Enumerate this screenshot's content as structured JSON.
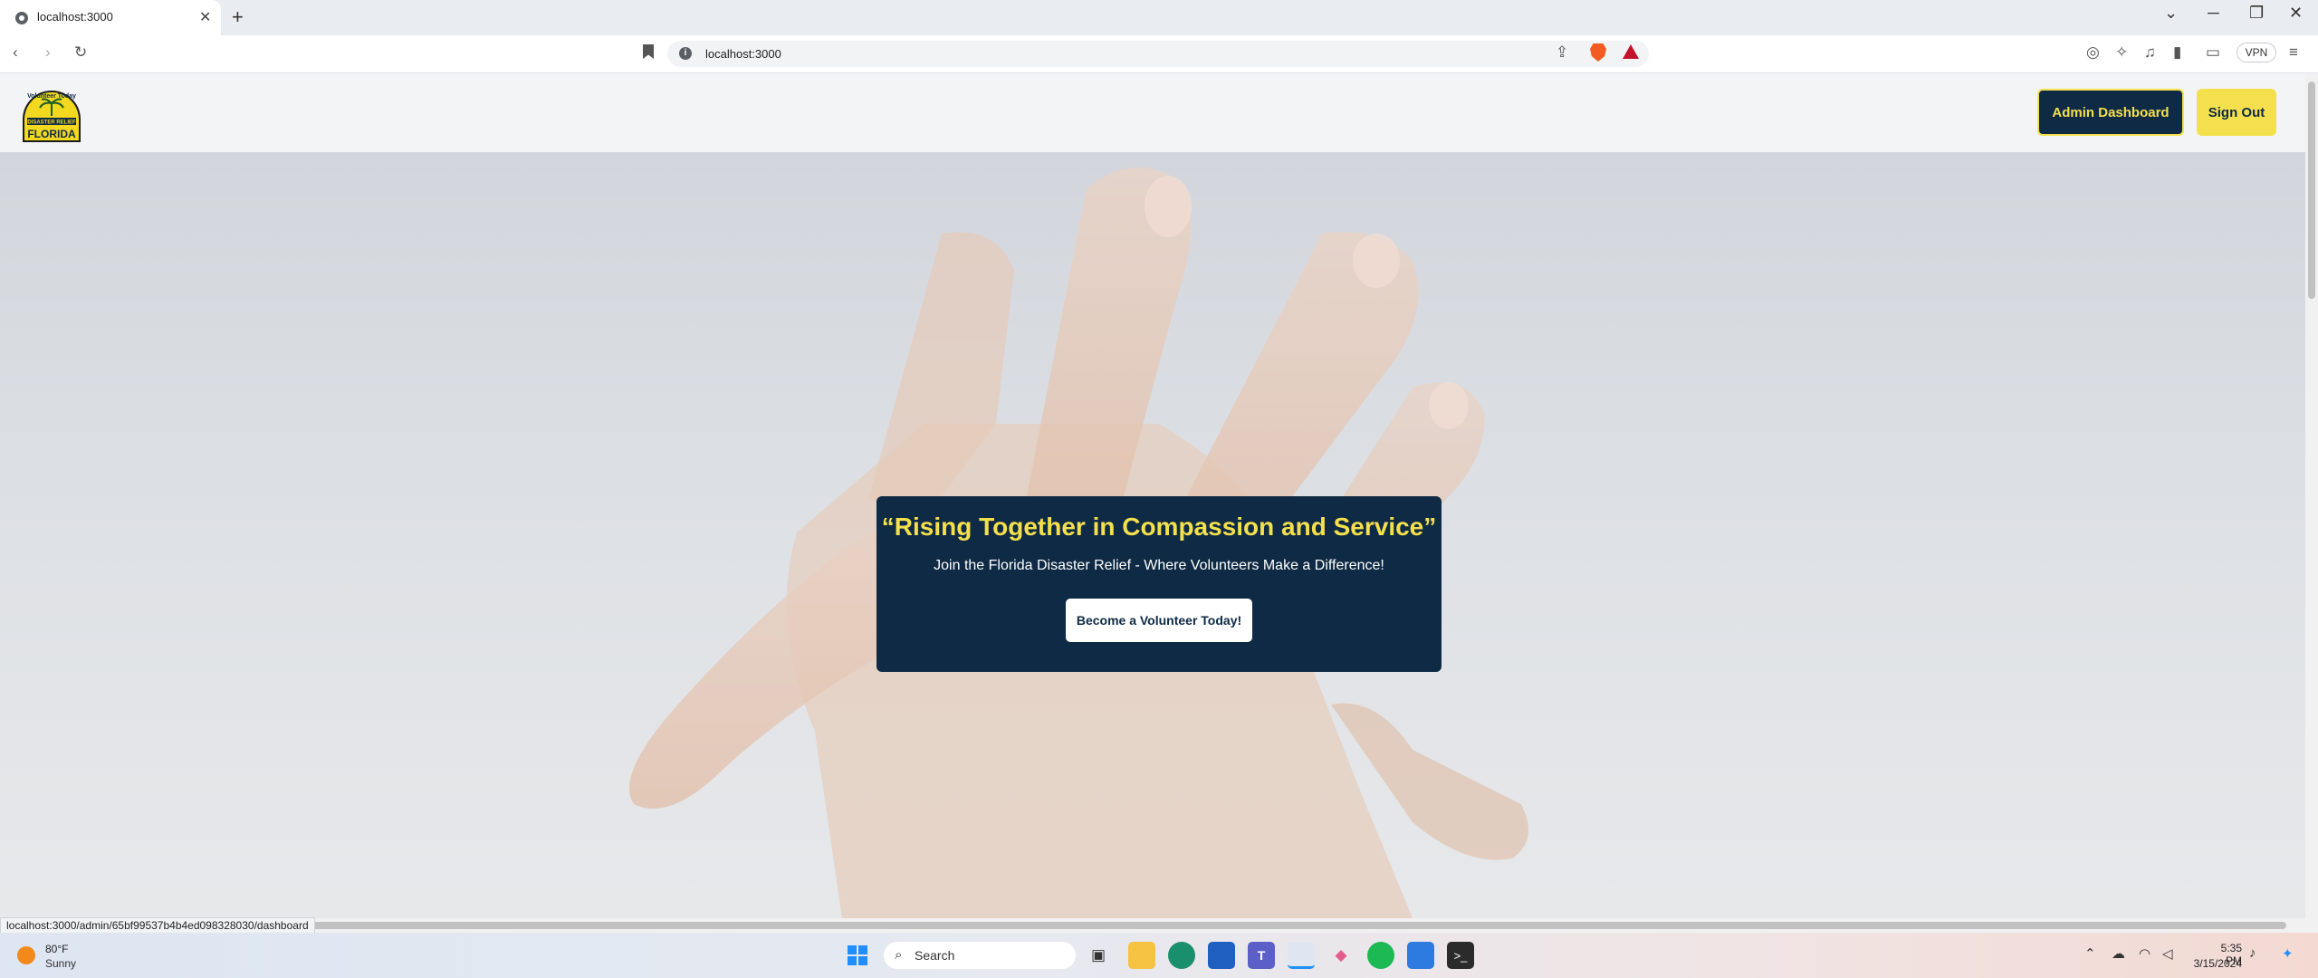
{
  "browser": {
    "tab_title": "localhost:3000",
    "tab_close": "✕",
    "new_tab": "+",
    "url": "localhost:3000",
    "vpn_label": "VPN",
    "status_url": "localhost:3000/admin/65bf99537b4b4ed098328030/dashboard"
  },
  "site": {
    "nav": {
      "admin_dashboard": "Admin Dashboard",
      "sign_out": "Sign Out"
    },
    "logo_text": "Volunteer Today DISASTER RELIEF FLORIDA",
    "hero": {
      "title": "“Rising Together in Compassion and Service”",
      "subtitle": "Join the Florida Disaster Relief - Where Volunteers Make a Difference!",
      "cta": "Become a Volunteer Today!"
    },
    "colors": {
      "navy": "#0e2a44",
      "yellow": "#f4e04d"
    }
  },
  "taskbar": {
    "weather_temp": "80°F",
    "weather_cond": "Sunny",
    "search_label": "Search",
    "time": "5:35 PM",
    "date": "3/15/2024"
  }
}
